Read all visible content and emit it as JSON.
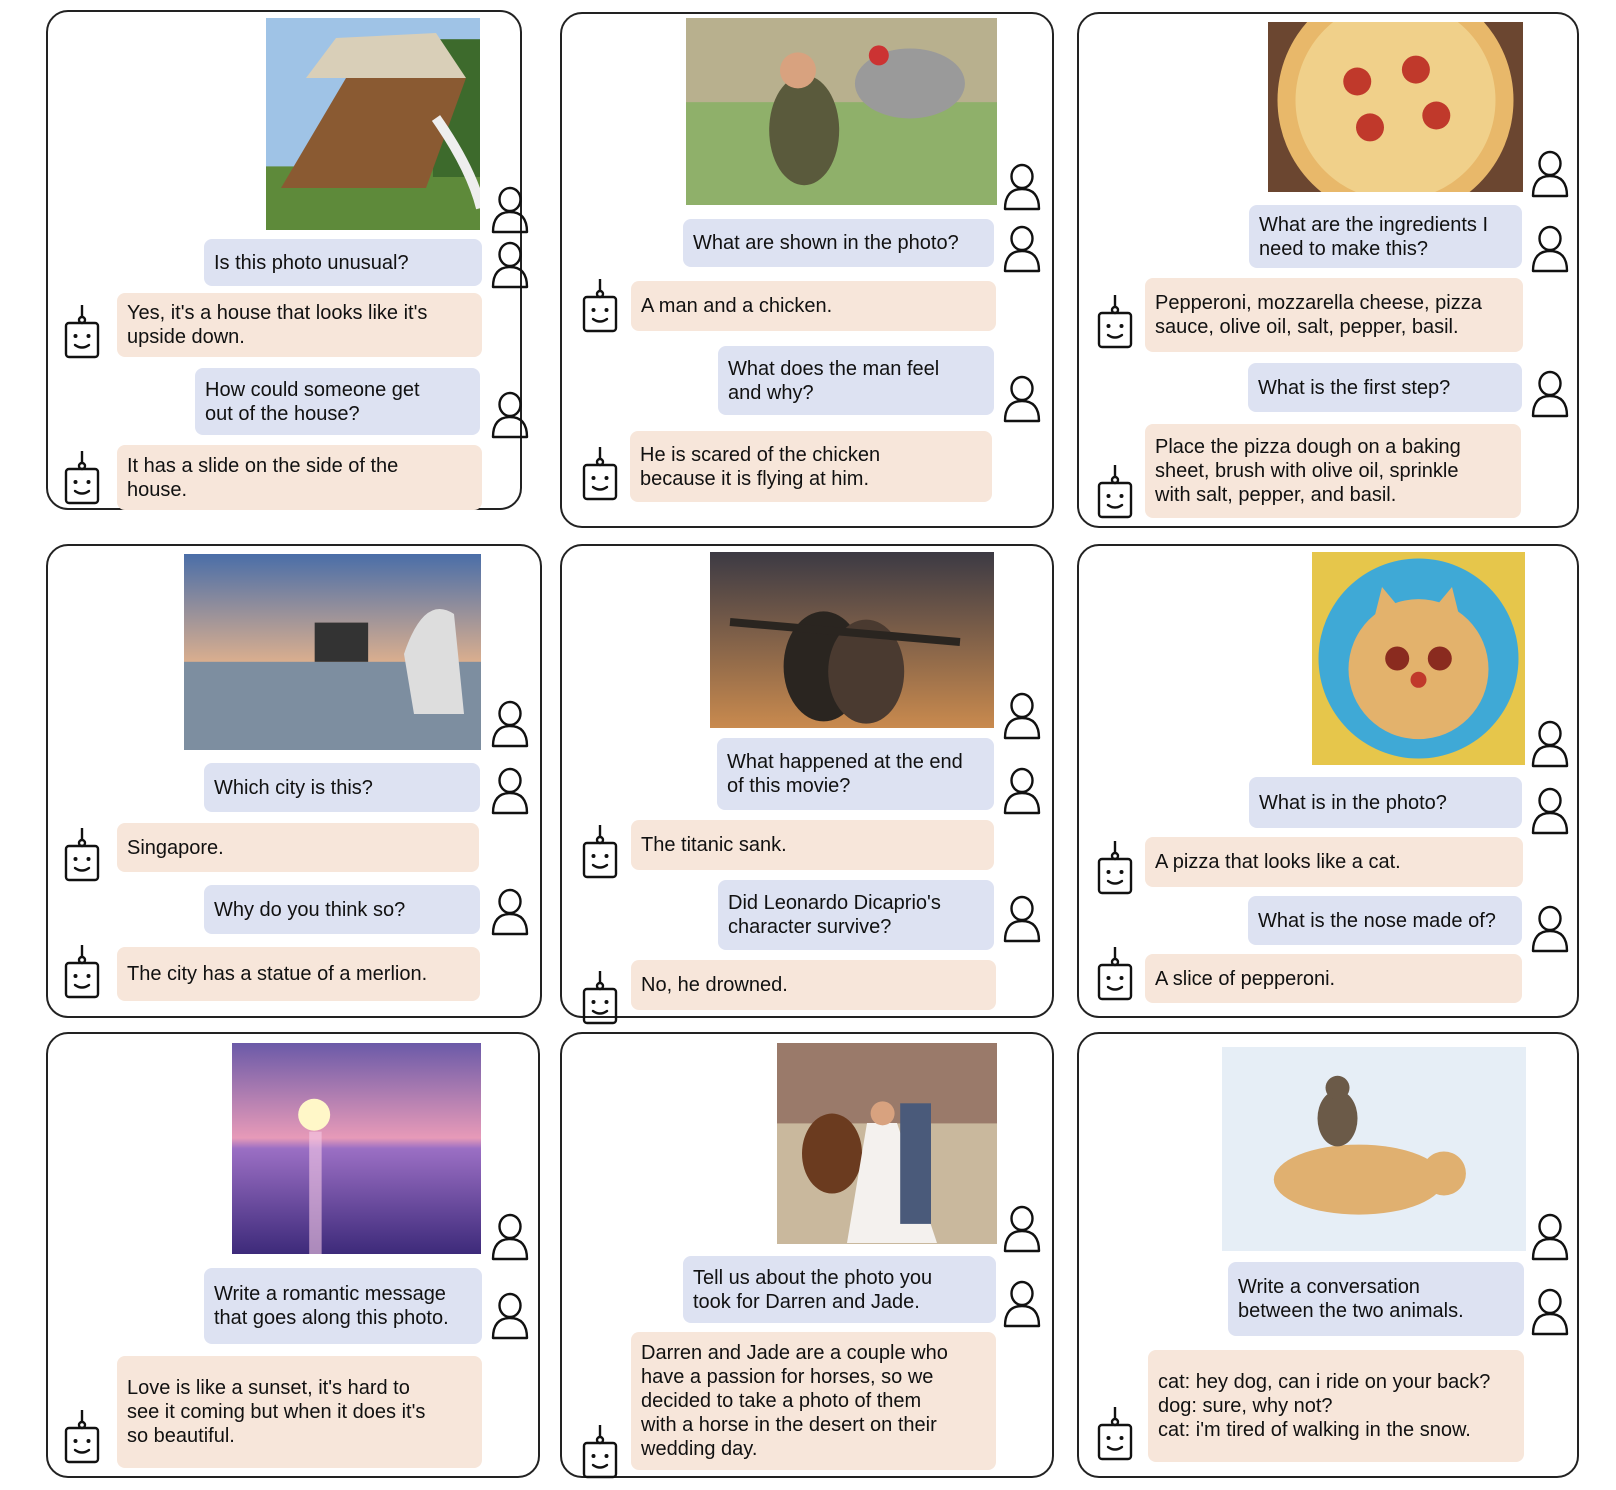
{
  "cards": [
    {
      "name": "card-house",
      "photo_icon": "upside-down-house-photo",
      "messages": [
        {
          "role": "user",
          "text": "Is this photo unusual?"
        },
        {
          "role": "assistant",
          "text": "Yes, it's a house that looks like it's\nupside down."
        },
        {
          "role": "user",
          "text": "How could someone get\nout of the house?"
        },
        {
          "role": "assistant",
          "text": "It has a slide on the side of the\nhouse."
        }
      ]
    },
    {
      "name": "card-chicken",
      "photo_icon": "man-and-chicken-photo",
      "messages": [
        {
          "role": "user",
          "text": "What are shown in the photo?"
        },
        {
          "role": "assistant",
          "text": "A man and a chicken."
        },
        {
          "role": "user",
          "text": "What does the man feel\nand why?"
        },
        {
          "role": "assistant",
          "text": "He is scared of the chicken\nbecause it is flying at him."
        }
      ]
    },
    {
      "name": "card-pizza",
      "photo_icon": "pepperoni-pizza-photo",
      "messages": [
        {
          "role": "user",
          "text": "What are the ingredients I\nneed to make this?"
        },
        {
          "role": "assistant",
          "text": "Pepperoni, mozzarella cheese, pizza\nsauce, olive oil, salt, pepper, basil."
        },
        {
          "role": "user",
          "text": "What is the first step?"
        },
        {
          "role": "assistant",
          "text": "Place the pizza dough on a baking\nsheet, brush with olive oil, sprinkle\nwith salt, pepper, and basil."
        }
      ]
    },
    {
      "name": "card-singapore",
      "photo_icon": "merlion-city-photo",
      "messages": [
        {
          "role": "user",
          "text": "Which city is this?"
        },
        {
          "role": "assistant",
          "text": "Singapore."
        },
        {
          "role": "user",
          "text": "Why do you think so?"
        },
        {
          "role": "assistant",
          "text": "The city has a statue of a merlion."
        }
      ]
    },
    {
      "name": "card-titanic",
      "photo_icon": "movie-scene-photo",
      "messages": [
        {
          "role": "user",
          "text": "What happened at the end\nof this movie?"
        },
        {
          "role": "assistant",
          "text": "The titanic sank."
        },
        {
          "role": "user",
          "text": "Did Leonardo Dicaprio's\ncharacter survive?"
        },
        {
          "role": "assistant",
          "text": "No, he drowned."
        }
      ]
    },
    {
      "name": "card-cat-pizza",
      "photo_icon": "cat-pizza-photo",
      "messages": [
        {
          "role": "user",
          "text": "What is in the photo?"
        },
        {
          "role": "assistant",
          "text": "A pizza that looks like a cat."
        },
        {
          "role": "user",
          "text": "What is the nose made of?"
        },
        {
          "role": "assistant",
          "text": "A slice of pepperoni."
        }
      ]
    },
    {
      "name": "card-sunset",
      "photo_icon": "sunset-sea-photo",
      "messages": [
        {
          "role": "user",
          "text": "Write a romantic message\nthat goes along this photo."
        },
        {
          "role": "assistant",
          "text": "Love is like a sunset, it's hard to\nsee it coming but when it does it's\nso beautiful."
        }
      ]
    },
    {
      "name": "card-wedding",
      "photo_icon": "wedding-horse-photo",
      "messages": [
        {
          "role": "user",
          "text": "Tell us about the photo you\ntook for Darren and Jade."
        },
        {
          "role": "assistant",
          "text": "Darren and Jade are a couple who\nhave a passion for horses, so we\ndecided to take a photo of them\nwith a horse in the desert on their\nwedding day."
        }
      ]
    },
    {
      "name": "card-cat-dog",
      "photo_icon": "cat-riding-dog-photo",
      "messages": [
        {
          "role": "user",
          "text": "Write a conversation\nbetween the two animals."
        },
        {
          "role": "assistant",
          "text": "cat: hey dog, can i ride on your back?\ndog: sure, why not?\ncat: i'm tired of walking in the snow."
        }
      ]
    }
  ],
  "icons": {
    "user": "person-icon",
    "assistant": "robot-icon"
  },
  "colors": {
    "user_bubble": "#dde2f2",
    "assistant_bubble": "#f7e6da",
    "border": "#222222"
  }
}
